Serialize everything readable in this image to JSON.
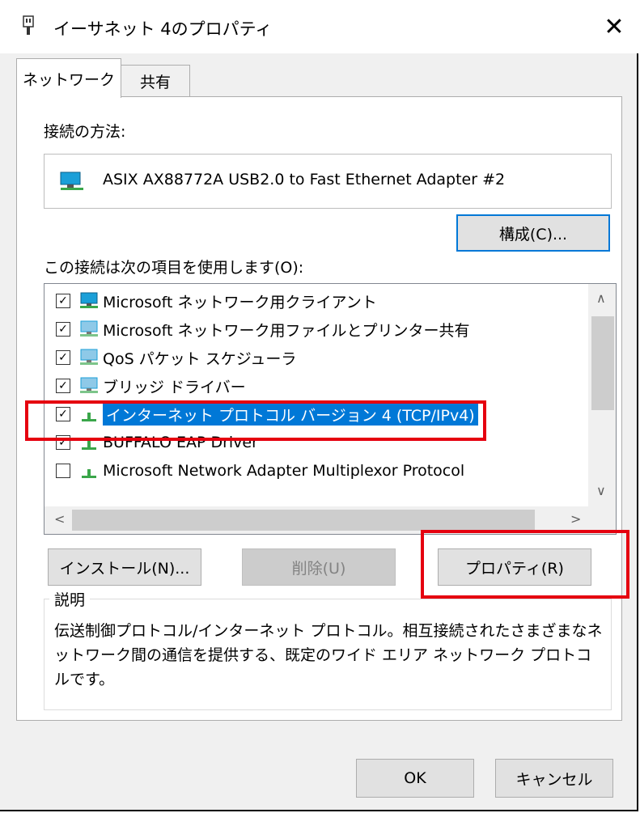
{
  "window": {
    "title": "イーサネット 4のプロパティ",
    "close_glyph": "✕"
  },
  "tabs": [
    {
      "label": "ネットワーク"
    },
    {
      "label": "共有"
    }
  ],
  "connect_using": {
    "label": "接続の方法:",
    "adapter_name": "ASIX AX88772A USB2.0 to Fast Ethernet Adapter #2"
  },
  "config_button": {
    "label": "構成(C)..."
  },
  "items_label": "この接続は次の項目を使用します(O):",
  "items": [
    {
      "label": "Microsoft ネットワーク用クライアント",
      "checked": true,
      "icon": "network-client-icon"
    },
    {
      "label": "Microsoft ネットワーク用ファイルとプリンター共有",
      "checked": true,
      "icon": "network-service-icon"
    },
    {
      "label": "QoS パケット スケジューラ",
      "checked": true,
      "icon": "network-service-icon"
    },
    {
      "label": "ブリッジ ドライバー",
      "checked": true,
      "icon": "network-service-icon"
    },
    {
      "label": "インターネット プロトコル バージョン 4 (TCP/IPv4)",
      "checked": true,
      "selected": true,
      "icon": "protocol-icon"
    },
    {
      "label": "BUFFALO EAP Driver",
      "checked": true,
      "icon": "protocol-icon"
    },
    {
      "label": "Microsoft Network Adapter Multiplexor Protocol",
      "checked": false,
      "icon": "protocol-icon"
    }
  ],
  "scroll_glyphs": {
    "up": "∧",
    "down": "∨",
    "left": "<",
    "right": ">"
  },
  "checkmark": "✓",
  "buttons": {
    "install": "インストール(N)...",
    "uninstall": "削除(U)",
    "properties": "プロパティ(R)",
    "ok": "OK",
    "cancel": "キャンセル"
  },
  "description": {
    "label": "説明",
    "text": "伝送制御プロトコル/インターネット プロトコル。相互接続されたさまざまなネットワーク間の通信を提供する、既定のワイド エリア ネットワーク プロトコルです。"
  },
  "colors": {
    "selection": "#0078d7",
    "highlight_box": "#e5000f",
    "icon_monitor": "#1a9fd8",
    "icon_protocol": "#3aa64a"
  }
}
